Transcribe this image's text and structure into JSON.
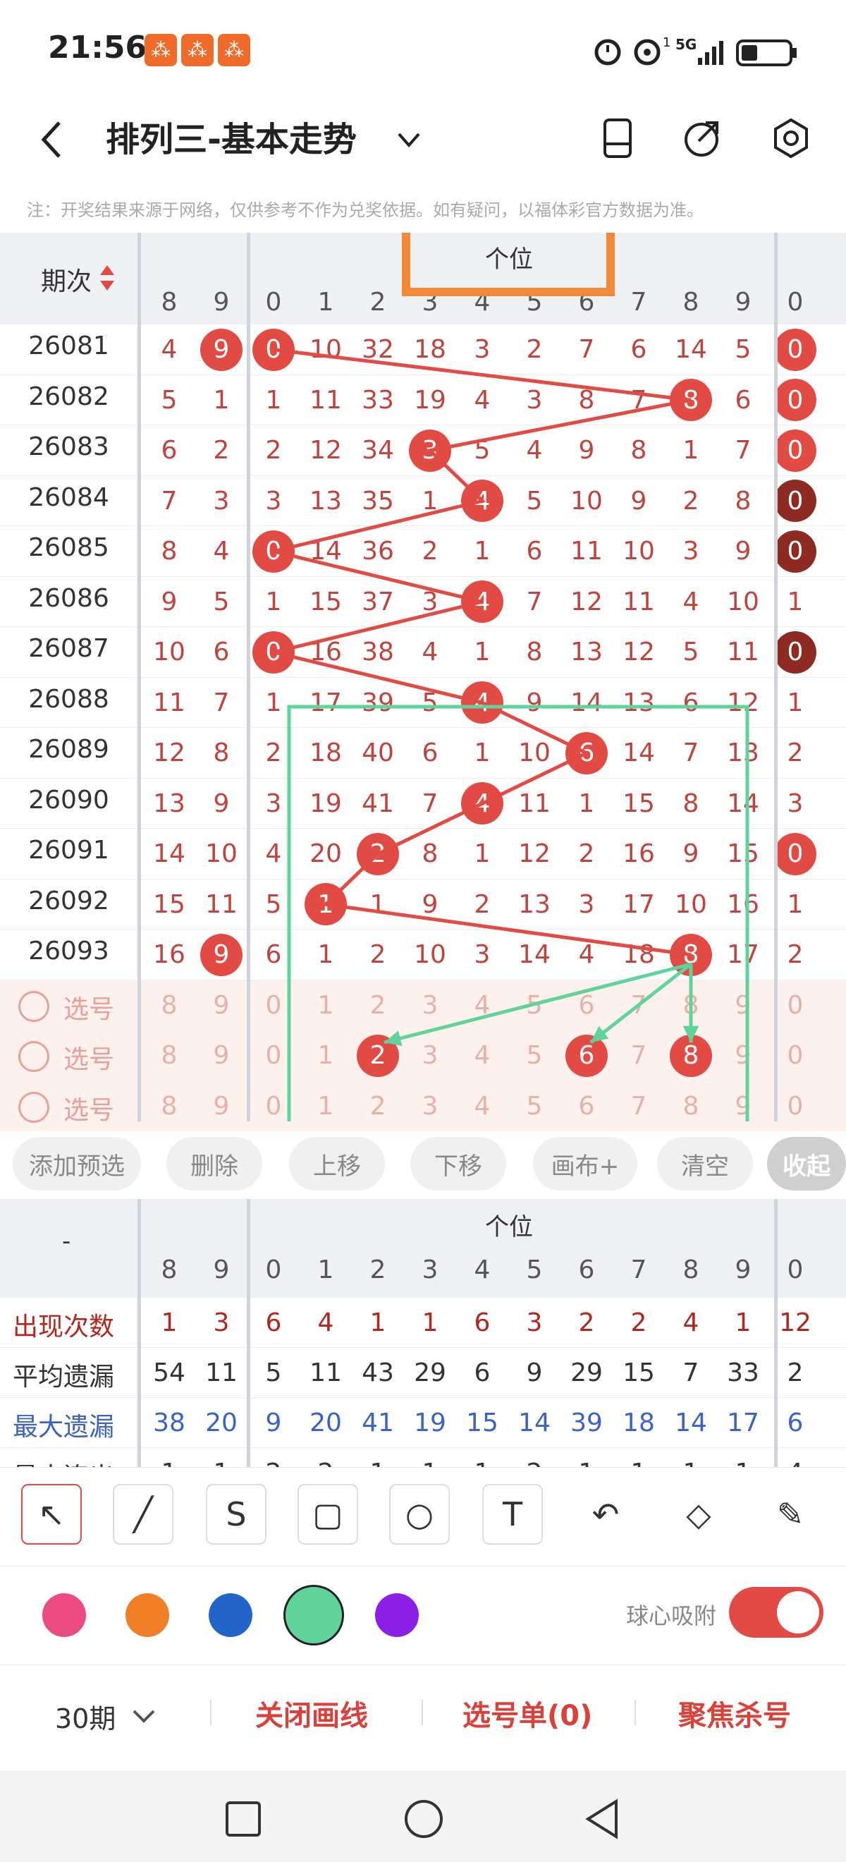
{
  "status_bar": {
    "time": "21:56",
    "network": "5G",
    "sim_index": "1"
  },
  "header": {
    "title": "排列三-基本走势",
    "back_icon": "back-arrow-icon",
    "dropdown_icon": "chevron-down-icon",
    "icons": [
      "phone-layout-icon",
      "share-icon",
      "settings-icon"
    ]
  },
  "notice": "注：开奖结果来源于网络，仅供参考不作为兑奖依据。如有疑问，以福体彩官方数据为准。",
  "table": {
    "period_header": "期次",
    "group_header": "个位",
    "column_labels": [
      "8",
      "9",
      "0",
      "1",
      "2",
      "3",
      "4",
      "5",
      "6",
      "7",
      "8",
      "9",
      "0"
    ],
    "rows": [
      {
        "period": "26081",
        "cells": [
          "4",
          "9",
          "0",
          "10",
          "32",
          "18",
          "3",
          "2",
          "7",
          "6",
          "14",
          "5",
          "0"
        ],
        "balls": [
          1,
          2
        ],
        "dark": [],
        "last_ball": true
      },
      {
        "period": "26082",
        "cells": [
          "5",
          "1",
          "1",
          "11",
          "33",
          "19",
          "4",
          "3",
          "8",
          "7",
          "8",
          "6",
          "0"
        ],
        "balls": [
          10
        ],
        "dark": [],
        "last_ball": true
      },
      {
        "period": "26083",
        "cells": [
          "6",
          "2",
          "2",
          "12",
          "34",
          "3",
          "5",
          "4",
          "9",
          "8",
          "1",
          "7",
          "0"
        ],
        "balls": [
          5
        ],
        "dark": [],
        "last_ball": true
      },
      {
        "period": "26084",
        "cells": [
          "7",
          "3",
          "3",
          "13",
          "35",
          "1",
          "4",
          "5",
          "10",
          "9",
          "2",
          "8",
          "0"
        ],
        "balls": [
          6
        ],
        "dark": [
          12
        ],
        "last_ball": false
      },
      {
        "period": "26085",
        "cells": [
          "8",
          "4",
          "0",
          "14",
          "36",
          "2",
          "1",
          "6",
          "11",
          "10",
          "3",
          "9",
          "0"
        ],
        "balls": [
          2
        ],
        "dark": [
          12
        ],
        "last_ball": false
      },
      {
        "period": "26086",
        "cells": [
          "9",
          "5",
          "1",
          "15",
          "37",
          "3",
          "4",
          "7",
          "12",
          "11",
          "4",
          "10",
          "1"
        ],
        "balls": [
          6
        ],
        "dark": [],
        "last_ball": false
      },
      {
        "period": "26087",
        "cells": [
          "10",
          "6",
          "0",
          "16",
          "38",
          "4",
          "1",
          "8",
          "13",
          "12",
          "5",
          "11",
          "0"
        ],
        "balls": [
          2
        ],
        "dark": [
          12
        ],
        "last_ball": false
      },
      {
        "period": "26088",
        "cells": [
          "11",
          "7",
          "1",
          "17",
          "39",
          "5",
          "4",
          "9",
          "14",
          "13",
          "6",
          "12",
          "1"
        ],
        "balls": [
          6
        ],
        "dark": [],
        "last_ball": false
      },
      {
        "period": "26089",
        "cells": [
          "12",
          "8",
          "2",
          "18",
          "40",
          "6",
          "1",
          "10",
          "6",
          "14",
          "7",
          "13",
          "2"
        ],
        "balls": [
          8
        ],
        "dark": [],
        "last_ball": false
      },
      {
        "period": "26090",
        "cells": [
          "13",
          "9",
          "3",
          "19",
          "41",
          "7",
          "4",
          "11",
          "1",
          "15",
          "8",
          "14",
          "3"
        ],
        "balls": [
          6
        ],
        "dark": [],
        "last_ball": false
      },
      {
        "period": "26091",
        "cells": [
          "14",
          "10",
          "4",
          "20",
          "2",
          "8",
          "1",
          "12",
          "2",
          "16",
          "9",
          "15",
          "0"
        ],
        "balls": [
          4
        ],
        "dark": [],
        "last_ball": true
      },
      {
        "period": "26092",
        "cells": [
          "15",
          "11",
          "5",
          "1",
          "1",
          "9",
          "2",
          "13",
          "3",
          "17",
          "10",
          "16",
          "1"
        ],
        "balls": [
          3
        ],
        "dark": [],
        "last_ball": false
      },
      {
        "period": "26093",
        "cells": [
          "16",
          "9",
          "6",
          "1",
          "2",
          "10",
          "3",
          "14",
          "4",
          "18",
          "8",
          "17",
          "2"
        ],
        "balls": [
          1,
          10
        ],
        "dark": [],
        "last_ball": false
      }
    ],
    "select_label": "选号",
    "select_rows": [
      {
        "cells": [
          "8",
          "9",
          "0",
          "1",
          "2",
          "3",
          "4",
          "5",
          "6",
          "7",
          "8",
          "9",
          "0"
        ],
        "balls": []
      },
      {
        "cells": [
          "8",
          "9",
          "0",
          "1",
          "2",
          "3",
          "4",
          "5",
          "6",
          "7",
          "8",
          "9",
          "0"
        ],
        "balls": [
          4,
          8,
          10
        ]
      },
      {
        "cells": [
          "8",
          "9",
          "0",
          "1",
          "2",
          "3",
          "4",
          "5",
          "6",
          "7",
          "8",
          "9",
          "0"
        ],
        "balls": []
      }
    ]
  },
  "action_buttons": [
    "添加预选",
    "删除",
    "上移",
    "下移",
    "画布+",
    "清空",
    "收起"
  ],
  "stats": {
    "corner": "-",
    "group_header": "个位",
    "column_labels": [
      "8",
      "9",
      "0",
      "1",
      "2",
      "3",
      "4",
      "5",
      "6",
      "7",
      "8",
      "9",
      "0"
    ],
    "rows": [
      {
        "label": "出现次数",
        "color": "#b2261e",
        "values": [
          "1",
          "3",
          "6",
          "4",
          "1",
          "1",
          "6",
          "3",
          "2",
          "2",
          "4",
          "1",
          "12"
        ]
      },
      {
        "label": "平均遗漏",
        "color": "#333333",
        "values": [
          "54",
          "11",
          "5",
          "11",
          "43",
          "29",
          "6",
          "9",
          "29",
          "15",
          "7",
          "33",
          "2"
        ]
      },
      {
        "label": "最大遗漏",
        "color": "#3b62c4",
        "values": [
          "38",
          "20",
          "9",
          "20",
          "41",
          "19",
          "15",
          "14",
          "39",
          "18",
          "14",
          "17",
          "6"
        ]
      },
      {
        "label": "最大连出",
        "color": "#333333",
        "values": [
          "1",
          "1",
          "2",
          "2",
          "1",
          "1",
          "1",
          "2",
          "1",
          "1",
          "1",
          "1",
          "4"
        ]
      }
    ]
  },
  "draw_tools": [
    "arrow-tool-icon",
    "line-tool-icon",
    "curve-tool-icon",
    "rectangle-tool-icon",
    "circle-tool-icon",
    "text-tool-icon",
    "undo-icon",
    "eraser-icon",
    "brush-clear-icon"
  ],
  "colors": {
    "ball_red": "#e24a44",
    "ball_dark": "#8f2a22",
    "swatches": [
      "#ec4b82",
      "#f08028",
      "#2264c8",
      "#5fd39a",
      "#8a1fe6"
    ],
    "selected_swatch": "#5fd39a",
    "orange_box": "#f0893a",
    "green_box": "#5fd39a"
  },
  "snap_toggle": {
    "label": "球心吸附",
    "on": true
  },
  "bottom_bar": {
    "period_count": "30期",
    "close_lines": "关闭画线",
    "pick_list": "选号单(0)",
    "focus_kill": "聚焦杀号"
  }
}
